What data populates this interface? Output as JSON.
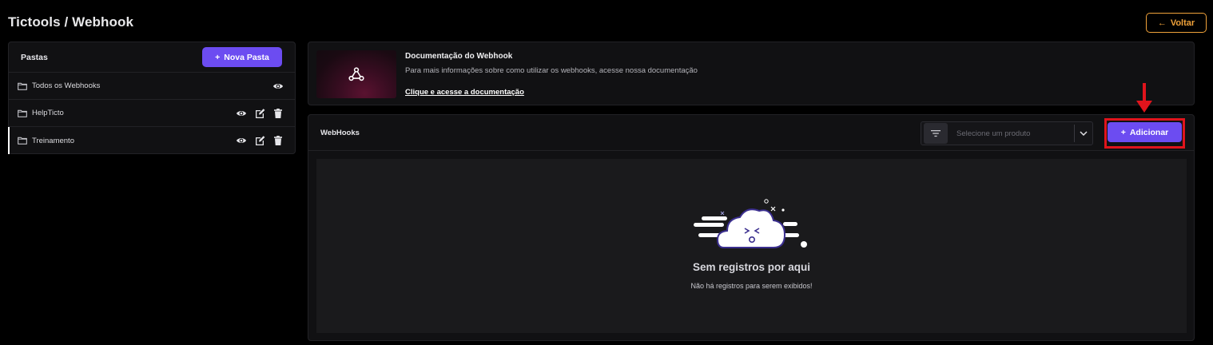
{
  "header": {
    "title": "Tictools / Webhook",
    "back_label": "Voltar"
  },
  "folders": {
    "title": "Pastas",
    "new_folder_label": "Nova Pasta",
    "items": [
      {
        "label": "Todos os Webhooks"
      },
      {
        "label": "HelpTicto"
      },
      {
        "label": "Treinamento"
      }
    ]
  },
  "documentation": {
    "title": "Documentação do Webhook",
    "description": "Para mais informações sobre como utilizar os webhooks, acesse nossa documentação",
    "link_label": "Clique e acesse a documentação"
  },
  "webhooks": {
    "title": "WebHooks",
    "product_select_placeholder": "Selecione um produto",
    "add_label": "Adicionar",
    "empty_title": "Sem registros por aqui",
    "empty_subtitle": "Não há registros para serem exibidos!"
  },
  "colors": {
    "accent": "#6c4cf1",
    "back_button": "#f0a23a",
    "highlight": "#e0141c",
    "background": "#000000",
    "panel": "#111113"
  },
  "icons": [
    "arrow-left-icon",
    "plus-icon",
    "folder-icon",
    "eye-icon",
    "edit-icon",
    "trash-icon",
    "webhook-icon",
    "filter-icon",
    "chevron-down-icon",
    "empty-cloud-illustration",
    "red-arrow-icon"
  ]
}
